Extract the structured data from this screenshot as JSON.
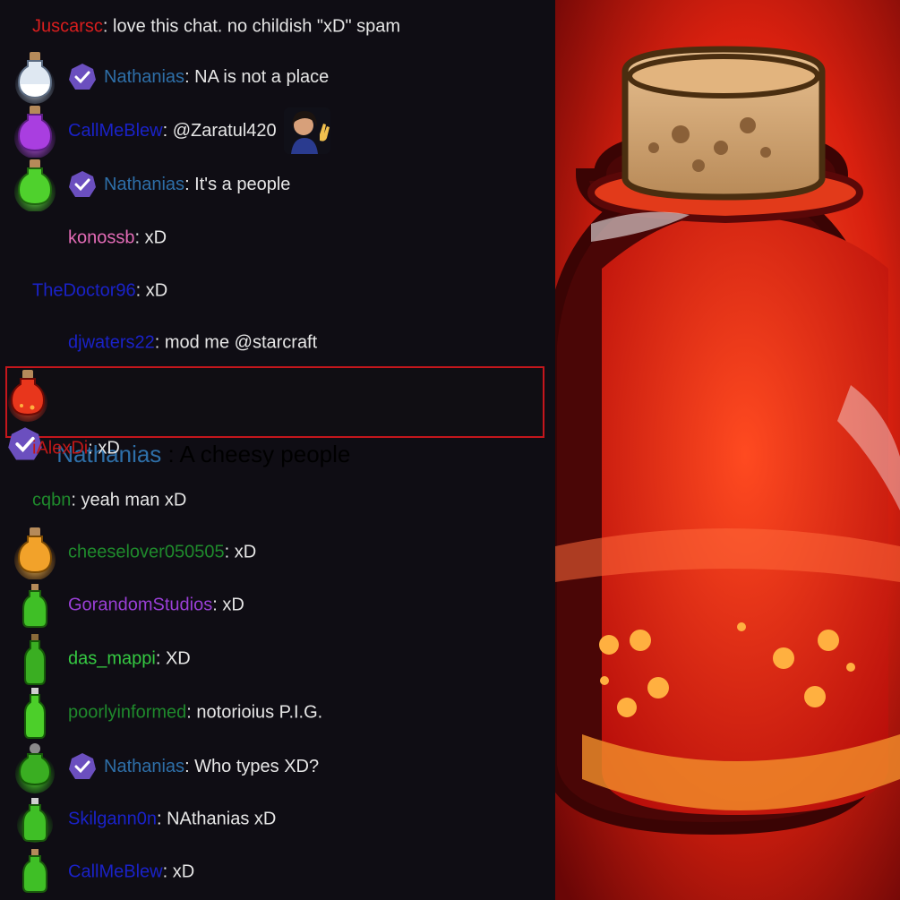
{
  "chat": {
    "messages": [
      {
        "user": "Juscarsc",
        "text": ": love this chat. no childish \"xD\" spam",
        "color": "#d91e1e",
        "badge": false,
        "potion": "none"
      },
      {
        "user": "Nathanias",
        "text": ": NA is not a place",
        "color": "#2e6fa8",
        "badge": true,
        "potion": "white"
      },
      {
        "user": "CallMeBlew",
        "text": ": @Zaratul420",
        "color": "#1a22c8",
        "badge": false,
        "potion": "purple",
        "emote": "waving-woman-emote"
      },
      {
        "user": "Nathanias",
        "text": ": It's a people",
        "color": "#2e6fa8",
        "badge": true,
        "potion": "green"
      },
      {
        "user": "konossb",
        "text": ": xD",
        "color": "#e36bb6",
        "badge": false,
        "potion": "none"
      },
      {
        "user": "TheDoctor96",
        "text": ": xD",
        "color": "#1a22c8",
        "badge": false,
        "potion": "none"
      },
      {
        "user": "djwaters22",
        "text": ": mod me @starcraft",
        "color": "#1a22c8",
        "badge": false,
        "potion": "none"
      },
      {
        "user": "Nathanias",
        "text": ": A cheesy people",
        "color": "#2e6fa8",
        "badge": true,
        "potion": "red",
        "highlighted": true
      },
      {
        "user": "iAlexDi",
        "text": ": xD",
        "color": "#c01818",
        "badge": false,
        "potion": "none"
      },
      {
        "user": "cqbn",
        "text": ": yeah man xD",
        "color": "#1f8a2c",
        "badge": false,
        "potion": "none"
      },
      {
        "user": "cheeselover050505",
        "text": ": xD",
        "color": "#1f8a2c",
        "badge": false,
        "potion": "orange"
      },
      {
        "user": "GorandomStudios",
        "text": ": xD",
        "color": "#9a3fd6",
        "badge": false,
        "potion": "green-small"
      },
      {
        "user": "das_mappi",
        "text": ": XD",
        "color": "#35c942",
        "badge": false,
        "potion": "green-tall"
      },
      {
        "user": "poorlyinformed",
        "text": ": notorioius P.I.G.",
        "color": "#1f8a2c",
        "badge": false,
        "potion": "green-tall"
      },
      {
        "user": "Nathanias",
        "text": ": Who types XD?",
        "color": "#2e6fa8",
        "badge": true,
        "potion": "green-skull"
      },
      {
        "user": "Skilgann0n",
        "text": ": NAthanias xD",
        "color": "#1a22c8",
        "badge": false,
        "potion": "green-small"
      },
      {
        "user": "CallMeBlew",
        "text": ": xD",
        "color": "#1a22c8",
        "badge": false,
        "potion": "green-small"
      }
    ]
  },
  "colors": {
    "background": "#0f0d14",
    "badge": "#6b4fbf",
    "highlight_border": "#c4161c",
    "art_background": "#c0130f"
  }
}
